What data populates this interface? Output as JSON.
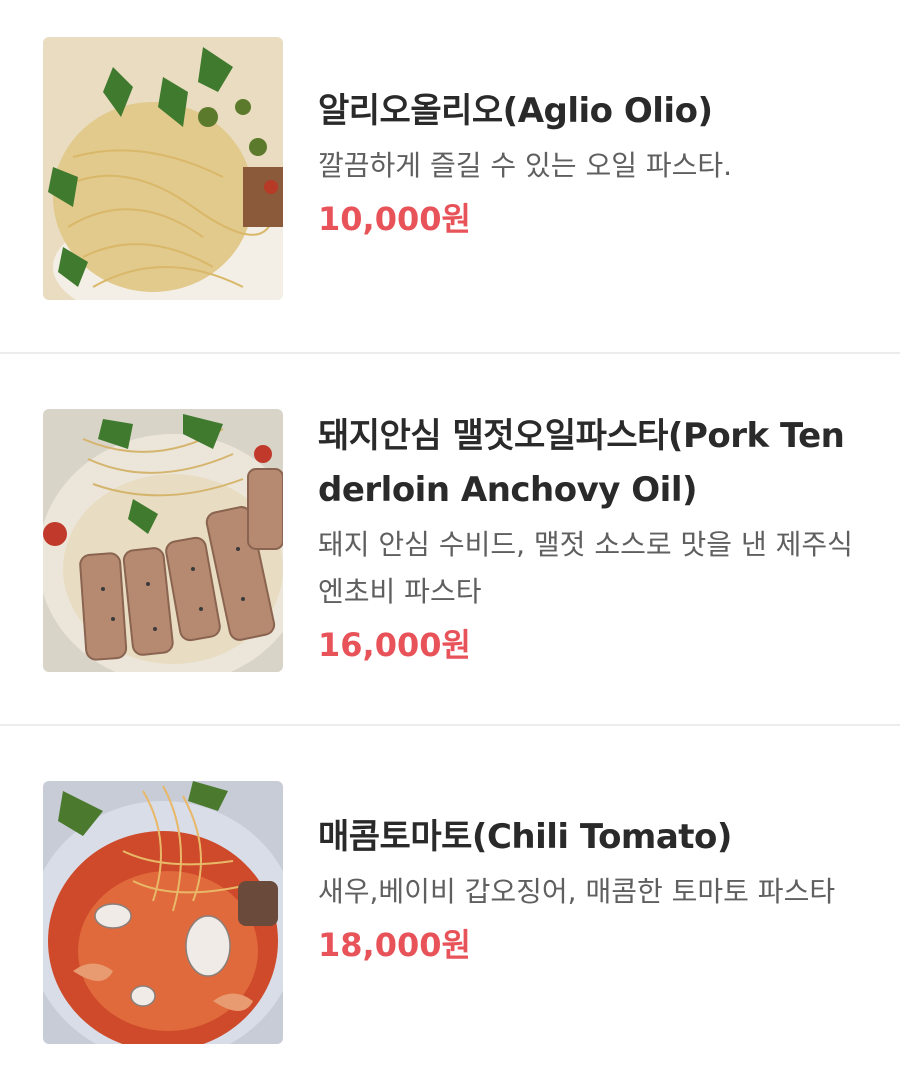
{
  "menu": {
    "items": [
      {
        "name": "알리오올리오(Aglio Olio)",
        "description": "깔끔하게 즐길 수 있는 오일 파스타.",
        "price": "10,000원",
        "image": "aglio-olio-pasta-photo"
      },
      {
        "name": "돼지안심 맬젓오일파스타(Pork Tenderloin Anchovy Oil)",
        "description": "돼지 안심 수비드, 맬젓 소스로 맛을 낸 제주식 엔초비 파스타",
        "price": "16,000원",
        "image": "pork-tenderloin-pasta-photo"
      },
      {
        "name": "매콤토마토(Chili Tomato)",
        "description": "새우,베이비 갑오징어, 매콤한 토마토 파스타",
        "price": "18,000원",
        "image": "chili-tomato-pasta-photo"
      }
    ]
  },
  "colors": {
    "price": "#e8535a",
    "divider": "#ececec",
    "name": "#2a2a2a",
    "description": "#5f5f5f"
  }
}
